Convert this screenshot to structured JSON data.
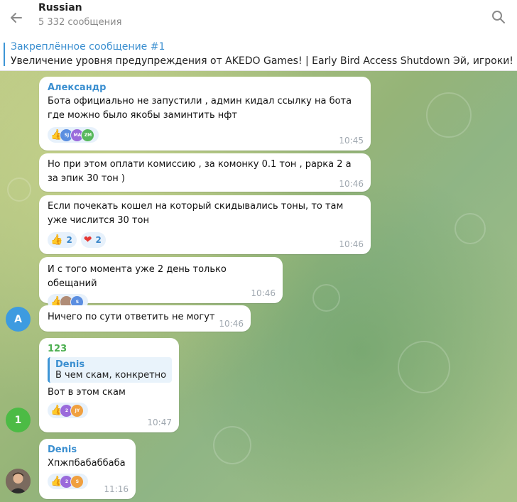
{
  "header": {
    "title": "Russian",
    "subtitle": "5 332 сообщения"
  },
  "pinned": {
    "title": "Закреплённое сообщение #1",
    "text": "Увеличение уровня предупреждения от AKEDO Games! | Early Bird Access Shutdown   Эй, игроки! Наш сервер"
  },
  "messages": [
    {
      "sender": "Александр",
      "sender_color": "#3b8fd0",
      "text": "Бота официально не запустили , админ кидал ссылку на бота где можно было якобы заминтить нфт",
      "time": "10:45",
      "reactors": [
        "SJ",
        "MA",
        "ZM"
      ]
    },
    {
      "text": "Но при этом оплати комиссию , за комонку 0.1 тон , рарка 2 а за эпик 30 тон )",
      "time": "10:46"
    },
    {
      "text": "Если почекать кошел на который скидывались тоны, то там уже числится 30 тон",
      "time": "10:46",
      "reactions": [
        {
          "emoji": "👍",
          "count": "2"
        },
        {
          "emoji": "❤",
          "count": "2"
        }
      ]
    },
    {
      "text": "И с того момента уже 2 день только обещаний",
      "time": "10:46",
      "reactors": [
        "",
        "S"
      ]
    },
    {
      "avatar": "A",
      "text": "Ничего по сути ответить не могут",
      "time": "10:46"
    },
    {
      "avatar": "1",
      "sender": "123",
      "sender_color": "#4caf50",
      "reply_name": "Denis",
      "reply_text": "В чем скам, конкретно",
      "text": "Вот в этом скам",
      "time": "10:47",
      "reactors": [
        "2",
        "JY"
      ]
    },
    {
      "sender": "Denis",
      "sender_color": "#3b8fd0",
      "text": "Хпжпбабаббаба",
      "time": "11:16",
      "reactors": [
        "2",
        "S"
      ]
    }
  ],
  "colors": {
    "accent": "#3d95d6",
    "avatar_a": "#3d9be0",
    "avatar_1": "#4cbb45"
  }
}
